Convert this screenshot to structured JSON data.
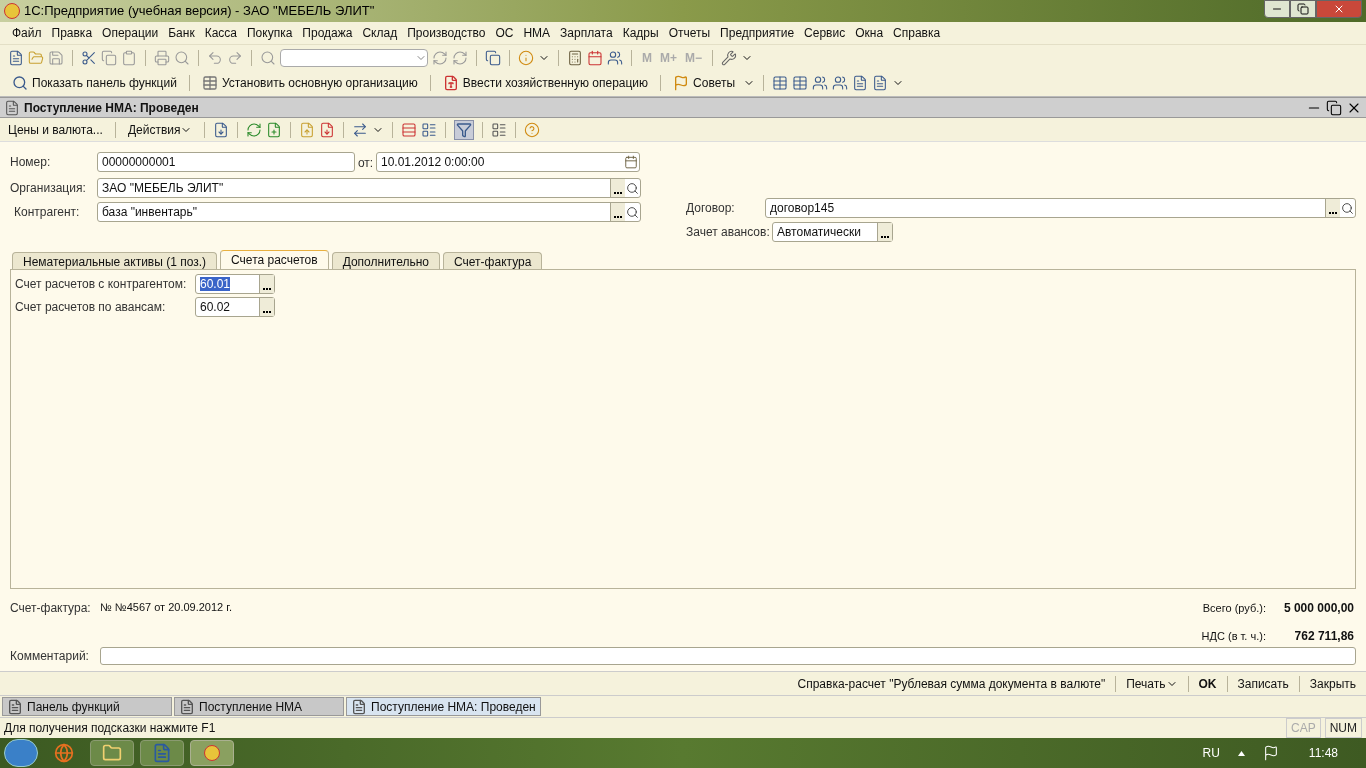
{
  "window": {
    "title": "1С:Предприятие (учебная версия) - ЗАО \"МЕБЕЛЬ ЭЛИТ\""
  },
  "menu": [
    "Файл",
    "Правка",
    "Операции",
    "Банк",
    "Касса",
    "Покупка",
    "Продажа",
    "Склад",
    "Производство",
    "ОС",
    "НМА",
    "Зарплата",
    "Кадры",
    "Отчеты",
    "Предприятие",
    "Сервис",
    "Окна",
    "Справка"
  ],
  "memory_buttons": [
    {
      "label": "M",
      "disabled": true
    },
    {
      "label": "M+",
      "disabled": true
    },
    {
      "label": "M−",
      "disabled": true
    }
  ],
  "toolbar_buttons": [
    {
      "label": "Показать панель функций"
    },
    {
      "label": "Установить основную организацию"
    },
    {
      "label": "Ввести хозяйственную операцию"
    },
    {
      "label": "Советы"
    }
  ],
  "document": {
    "title": "Поступление НМА: Проведен",
    "toolbar": [
      {
        "label": "Цены и валюта..."
      },
      {
        "label": "Действия"
      }
    ],
    "fields": {
      "number": {
        "label": "Номер:",
        "value": "00000000001"
      },
      "date": {
        "label": "от:",
        "value": "10.01.2012  0:00:00"
      },
      "organization": {
        "label": "Организация:",
        "value": "ЗАО \"МЕБЕЛЬ ЭЛИТ\""
      },
      "counterparty": {
        "label": "Контрагент:",
        "value": "база \"инвентарь\""
      },
      "contract": {
        "label": "Договор:",
        "value": "договор145"
      },
      "advance_offset": {
        "label": "Зачет авансов:",
        "value": "Автоматически"
      }
    },
    "tabs": [
      {
        "label": "Нематериальные активы (1 поз.)",
        "selected": false
      },
      {
        "label": "Счета расчетов",
        "selected": true
      },
      {
        "label": "Дополнительно",
        "selected": false
      },
      {
        "label": "Счет-фактура",
        "selected": false
      }
    ],
    "tab_fields": [
      {
        "label": "Счет расчетов с контрагентом:",
        "value": "60.01",
        "selected": true
      },
      {
        "label": "Счет расчетов по авансам:",
        "value": "60.02",
        "selected": false
      }
    ],
    "invoice": {
      "label": "Счет-фактура:",
      "value": "№ №4567 от 20.09.2012 г."
    },
    "totals": [
      {
        "label": "Всего (руб.):",
        "value": "5 000 000,00"
      },
      {
        "label": "НДС (в т. ч.):",
        "value": "762 711,86"
      }
    ],
    "comment": {
      "label": "Комментарий:"
    },
    "buttons": [
      {
        "label": "Справка-расчет \"Рублевая сумма документа в валюте\"",
        "kind": "plain"
      },
      {
        "label": "Печать",
        "kind": "dropdown"
      },
      {
        "label": "OK",
        "kind": "default"
      },
      {
        "label": "Записать",
        "kind": "plain"
      },
      {
        "label": "Закрыть",
        "kind": "plain"
      }
    ]
  },
  "window_tabs": [
    {
      "label": "Панель функций",
      "selected": false
    },
    {
      "label": "Поступление НМА",
      "selected": false
    },
    {
      "label": "Поступление НМА: Проведен",
      "selected": true
    }
  ],
  "status_bar": {
    "hint": "Для получения подсказки нажмите F1",
    "indicators": [
      {
        "label": "CAP",
        "on": false
      },
      {
        "label": "NUM",
        "on": true
      }
    ]
  },
  "taskbar": {
    "language": "RU",
    "time": "11:48"
  }
}
